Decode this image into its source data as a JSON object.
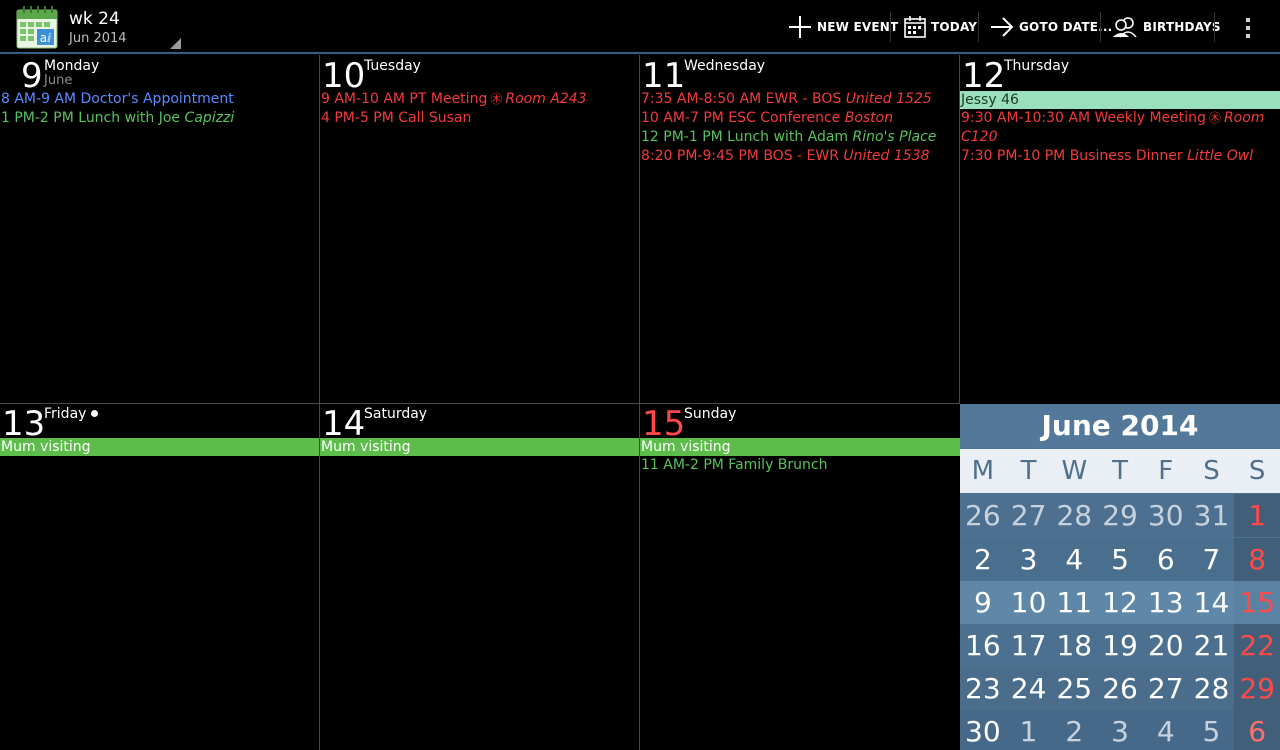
{
  "header": {
    "title": "wk 24",
    "subtitle": "Jun 2014",
    "app_icon": "aCalendar-icon",
    "buttons": {
      "new_event": "NEW EVENT",
      "today": "TODAY",
      "goto_date": "GOTO DATE...",
      "birthdays": "BIRTHDAYS"
    }
  },
  "colors": {
    "accent_line": "#2f5f84",
    "event_blue": "#5a8bff",
    "event_green": "#58c25a",
    "event_red": "#f33a3a",
    "allday_mint": "#9be0bd",
    "allday_green": "#5cbd4a",
    "sunday": "#ff4848",
    "mini_bg": "#4a7393"
  },
  "days": [
    {
      "num": "9",
      "name": "Monday",
      "month": "June",
      "events": [
        {
          "time": "8 AM-9 AM Doctor's Appointment",
          "loc": ""
        },
        {
          "time": "1 PM-2 PM Lunch with Joe",
          "loc": "Capizzi"
        }
      ]
    },
    {
      "num": "10",
      "name": "Tuesday",
      "events": [
        {
          "time": "9 AM-10 AM PT Meeting",
          "loc": "Room A243"
        },
        {
          "time": "4 PM-5 PM Call Susan",
          "loc": ""
        }
      ]
    },
    {
      "num": "11",
      "name": "Wednesday",
      "events": [
        {
          "time": "7:35 AM-8:50 AM EWR - BOS",
          "loc": "United 1525"
        },
        {
          "time": "10 AM-7 PM ESC Conference",
          "loc": "Boston"
        },
        {
          "time": "12 PM-1 PM Lunch with Adam",
          "loc": "Rino's Place"
        },
        {
          "time": "8:20 PM-9:45 PM BOS - EWR",
          "loc": "United 1538"
        }
      ]
    },
    {
      "num": "12",
      "name": "Thursday",
      "allday": "Jessy 46",
      "events": [
        {
          "time": "9:30 AM-10:30 AM Weekly Meeting",
          "loc": "Room C120"
        },
        {
          "time": "7:30 PM-10 PM Business Dinner",
          "loc": "Little Owl"
        }
      ]
    },
    {
      "num": "13",
      "name": "Friday",
      "allday": "Mum visiting",
      "events": []
    },
    {
      "num": "14",
      "name": "Saturday",
      "allday": "Mum visiting",
      "events": []
    },
    {
      "num": "15",
      "name": "Sunday",
      "allday": "Mum visiting",
      "events": [
        {
          "time": "11 AM-2 PM Family Brunch",
          "loc": ""
        }
      ]
    }
  ],
  "mini_month": {
    "title": "June 2014",
    "weekdays": [
      "M",
      "T",
      "W",
      "T",
      "F",
      "S",
      "S"
    ],
    "weeks": [
      [
        "26",
        "27",
        "28",
        "29",
        "30",
        "31",
        "1"
      ],
      [
        "2",
        "3",
        "4",
        "5",
        "6",
        "7",
        "8"
      ],
      [
        "9",
        "10",
        "11",
        "12",
        "13",
        "14",
        "15"
      ],
      [
        "16",
        "17",
        "18",
        "19",
        "20",
        "21",
        "22"
      ],
      [
        "23",
        "24",
        "25",
        "26",
        "27",
        "28",
        "29"
      ],
      [
        "30",
        "1",
        "2",
        "3",
        "4",
        "5",
        "6"
      ]
    ],
    "current_week_index": 2
  }
}
